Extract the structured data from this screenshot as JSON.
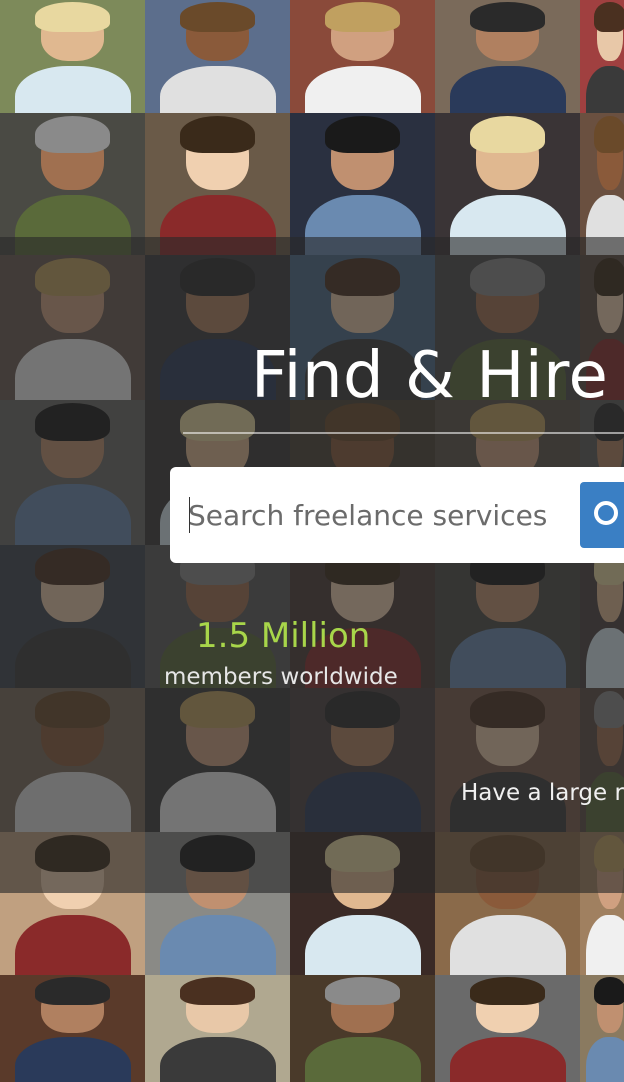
{
  "hero": {
    "title": "Find & Hire"
  },
  "search": {
    "placeholder": "Search freelance services",
    "value": ""
  },
  "stats": {
    "number": "1.5 Million",
    "label": "members worldwide"
  },
  "promo": {
    "text": "Have a large r"
  },
  "colors": {
    "accent_green": "#a8d64a",
    "search_button": "#3a7fc4",
    "overlay": "#282828"
  },
  "icons": {
    "search": "magnifier-icon"
  },
  "background": {
    "description_type": "photo-mosaic",
    "tile_count": 40
  }
}
